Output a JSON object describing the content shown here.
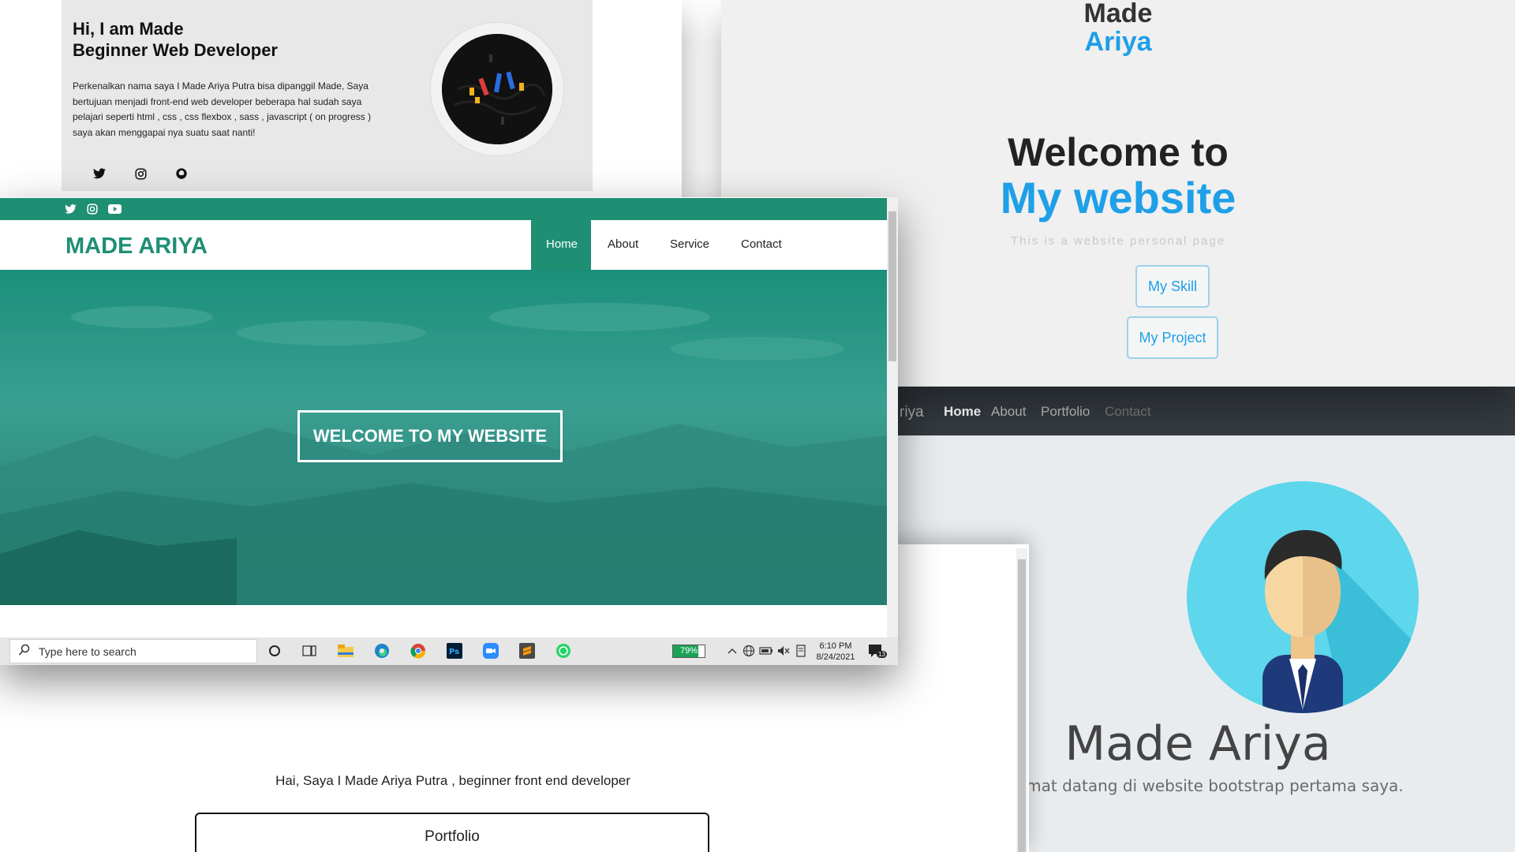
{
  "card_intro": {
    "greeting": "Hi, I am Made",
    "role": "Beginner Web Developer",
    "description": "Perkenalkan nama saya I Made Ariya Putra bisa dipanggil Made, Saya bertujuan menjadi front-end web developer beberapa hal sudah saya pelajari seperti html , css , css flexbox , sass , javascript ( on progress ) saya akan menggapai nya suatu saat nanti!",
    "social_icons": [
      "twitter-icon",
      "instagram-icon",
      "github-icon"
    ]
  },
  "card_welcome": {
    "name_first": "Made",
    "name_last": "Ariya",
    "heading_line1": "Welcome to",
    "heading_line2": "My website",
    "subtitle": "This is a website personal page",
    "btn_skill": "My Skill",
    "btn_project": "My Project",
    "accent_color": "#1e9fe8"
  },
  "card_bootstrap": {
    "brand_partial": "riya",
    "nav": [
      "Home",
      "About",
      "Portfolio",
      "Contact"
    ],
    "name": "Made Ariya",
    "tagline": "Selamat datang di website bootstrap pertama saya."
  },
  "card_simple": {
    "intro": "Hai, Saya I Made Ariya Putra , beginner front end developer",
    "button": "Portfolio"
  },
  "card_main": {
    "logo": "MADE ARIYA",
    "nav": [
      "Home",
      "About",
      "Service",
      "Contact"
    ],
    "active_nav": "Home",
    "hero_text": "WELCOME TO MY WEBSITE",
    "brand_color": "#1f8f74",
    "topbar_icons": [
      "twitter-icon",
      "instagram-icon",
      "youtube-icon"
    ]
  },
  "taskbar": {
    "search_placeholder": "Type here to search",
    "battery_percent": 79,
    "battery_label": "79%",
    "time": "6:10 PM",
    "date": "8/24/2021",
    "notification_count": "13"
  }
}
